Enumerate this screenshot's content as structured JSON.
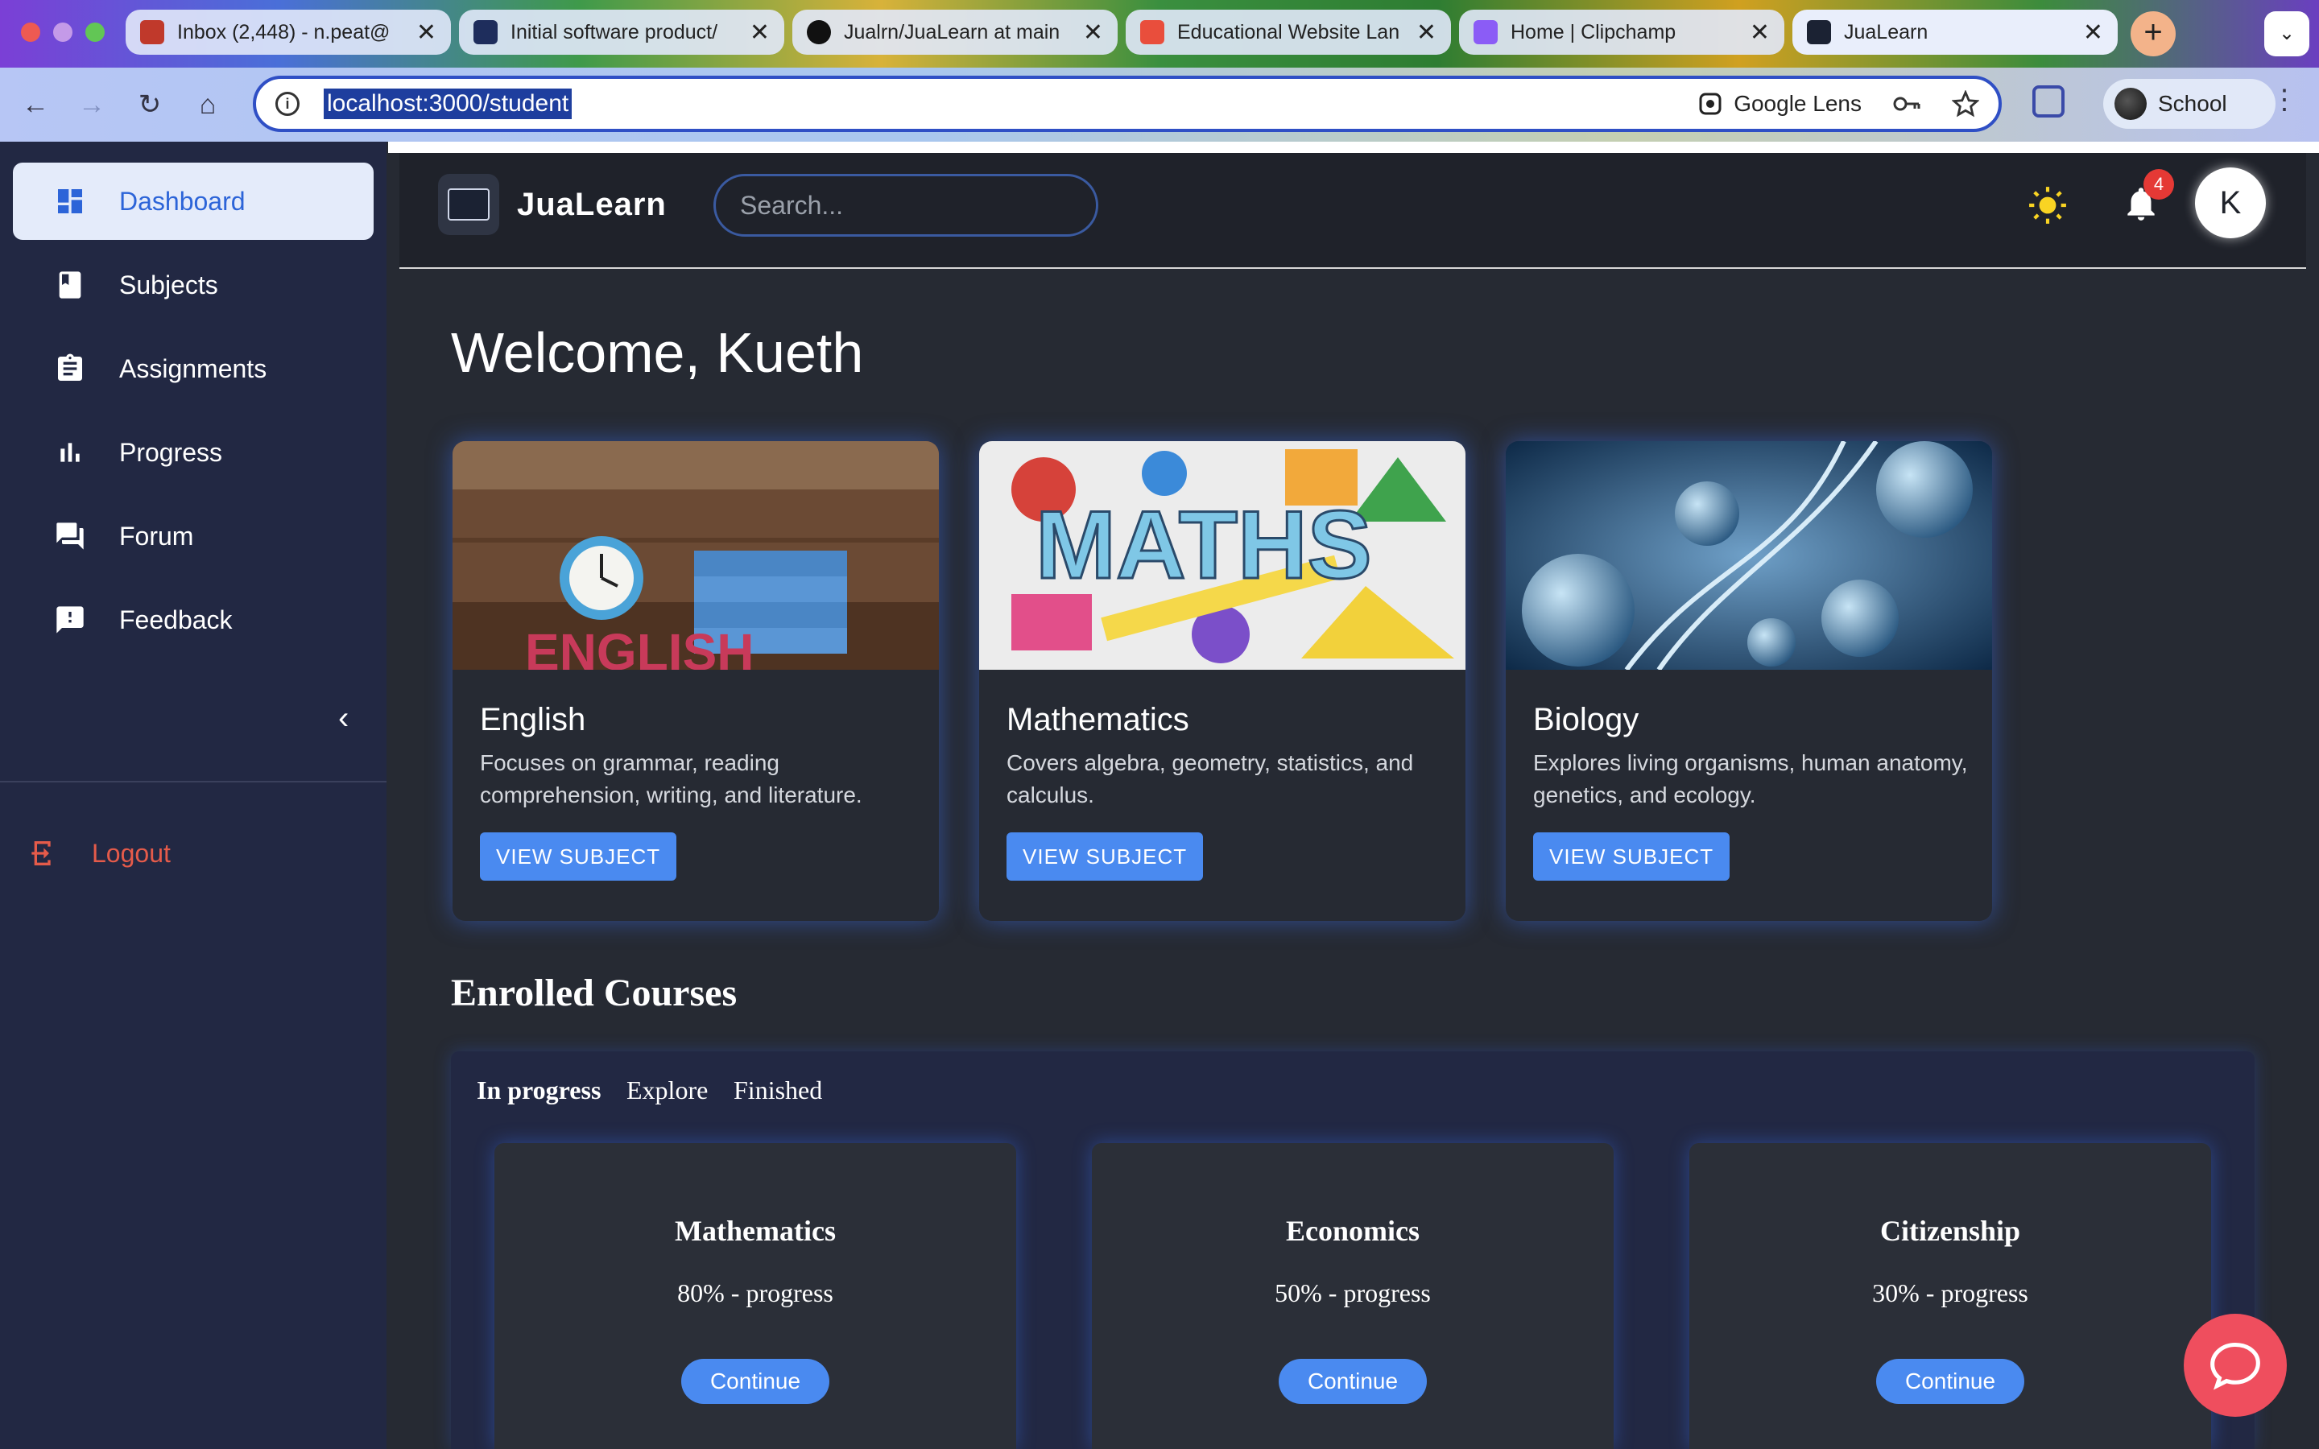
{
  "browser": {
    "tabs": [
      {
        "title": "Inbox (2,448) - n.peat@",
        "favicon_color": "#c0392b",
        "active": false
      },
      {
        "title": "Initial software product/",
        "favicon_color": "#1e2d5c",
        "active": false
      },
      {
        "title": "Jualrn/JuaLearn at main",
        "favicon_color": "#111111",
        "active": false
      },
      {
        "title": "Educational Website Lan",
        "favicon_color": "#e94e3c",
        "active": false
      },
      {
        "title": "Home | Clipchamp",
        "favicon_color": "#8b5cf6",
        "active": false
      },
      {
        "title": "JuaLearn",
        "favicon_color": "#1b2233",
        "active": true
      }
    ],
    "close_glyph": "✕",
    "new_tab_glyph": "+",
    "tab_menu_glyph": "⌄",
    "url": "localhost:3000/student",
    "google_lens_label": "Google Lens",
    "profile_label": "School",
    "nav": {
      "back": "←",
      "forward": "→",
      "reload": "↻",
      "home": "⌂",
      "menu": "⋮"
    }
  },
  "sidebar": {
    "items": [
      {
        "label": "Dashboard",
        "icon": "dashboard-icon",
        "active": true
      },
      {
        "label": "Subjects",
        "icon": "book-icon",
        "active": false
      },
      {
        "label": "Assignments",
        "icon": "clipboard-icon",
        "active": false
      },
      {
        "label": "Progress",
        "icon": "bar-chart-icon",
        "active": false
      },
      {
        "label": "Forum",
        "icon": "forum-icon",
        "active": false
      },
      {
        "label": "Feedback",
        "icon": "feedback-icon",
        "active": false
      }
    ],
    "collapse_glyph": "‹",
    "logout_label": "Logout"
  },
  "header": {
    "brand": "JuaLearn",
    "search_placeholder": "Search...",
    "notification_count": "4",
    "avatar_initial": "K"
  },
  "main": {
    "welcome": "Welcome, Kueth",
    "subjects": [
      {
        "name": "English",
        "description": "Focuses on grammar, reading comprehension, writing, and literature.",
        "button": "VIEW SUBJECT",
        "image": "english-books-clock-image"
      },
      {
        "name": "Mathematics",
        "description": "Covers algebra, geometry, statistics, and calculus.",
        "button": "VIEW SUBJECT",
        "image": "maths-doodle-image"
      },
      {
        "name": "Biology",
        "description": "Explores living organisms, human anatomy, genetics, and ecology.",
        "button": "VIEW SUBJECT",
        "image": "dna-cells-image"
      }
    ],
    "enrolled_title": "Enrolled Courses",
    "enrolled_tabs": [
      "In progress",
      "Explore",
      "Finished"
    ],
    "courses": [
      {
        "name": "Mathematics",
        "progress_text": "80% - progress",
        "progress": 0.8,
        "button": "Continue"
      },
      {
        "name": "Economics",
        "progress_text": "50% - progress",
        "progress": 0.5,
        "button": "Continue"
      },
      {
        "name": "Citizenship",
        "progress_text": "30% - progress",
        "progress": 0.3,
        "button": "Continue"
      }
    ]
  },
  "colors": {
    "accent": "#4a8af0",
    "sidebar_bg": "#222843",
    "content_bg": "#262a33",
    "logout": "#e55b4a",
    "badge": "#e53935",
    "chat_fab": "#ef4e5e"
  }
}
